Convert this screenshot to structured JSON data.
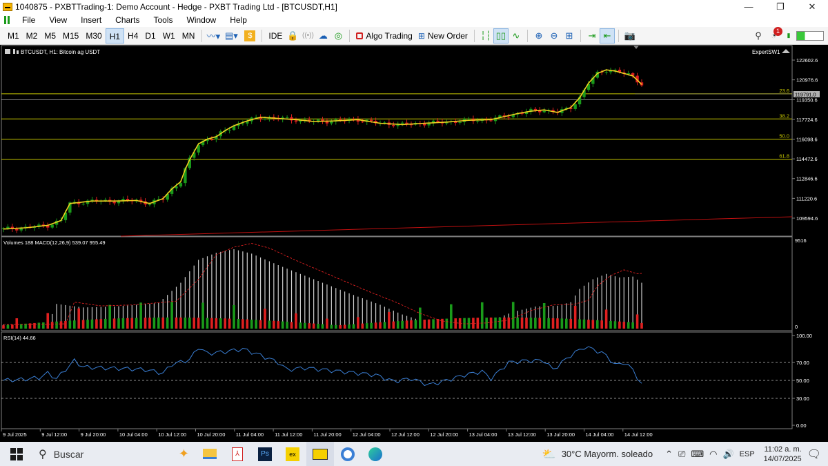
{
  "window": {
    "title": "1040875 - PXBTTrading-1: Demo Account - Hedge - PXBT Trading Ltd - [BTCUSDT,H1]",
    "controls": [
      "minimize",
      "restore",
      "close"
    ]
  },
  "menu": {
    "items": [
      "File",
      "View",
      "Insert",
      "Charts",
      "Tools",
      "Window",
      "Help"
    ]
  },
  "toolbar": {
    "timeframes": [
      "M1",
      "M2",
      "M5",
      "M15",
      "M30",
      "H1",
      "H4",
      "D1",
      "W1",
      "MN"
    ],
    "active_timeframe": "H1",
    "ide_label": "IDE",
    "algo_label": "Algo Trading",
    "order_label": "New Order",
    "notification_count": "1"
  },
  "chart": {
    "header": "BTCUSDT, H1:  Bitcoin ag USDT",
    "expert": "ExpertSW1",
    "current_price": "119791.0",
    "price_ticks": [
      "122602.6",
      "120976.6",
      "119350.6",
      "117724.6",
      "116098.6",
      "114472.6",
      "112846.6",
      "111220.6",
      "109594.6"
    ],
    "fib_levels": [
      {
        "label": "23.6",
        "price": 119830
      },
      {
        "label": "38.2",
        "price": 117760
      },
      {
        "label": "50.0",
        "price": 116100
      },
      {
        "label": "61.8",
        "price": 114440
      }
    ],
    "volume_header": "Volumes 188 MACD(12,26,9) 539.07 955.49",
    "volume_max_label": "9516",
    "volume_zero_label": "0",
    "rsi_header": "RSI(14) 44.66",
    "rsi_ticks": [
      "100.00",
      "70.00",
      "50.00",
      "30.00",
      "0.00"
    ],
    "time_labels": [
      "9 Jul 2025",
      "9 Jul 12:00",
      "9 Jul 20:00",
      "10 Jul 04:00",
      "10 Jul 12:00",
      "10 Jul 20:00",
      "11 Jul 04:00",
      "11 Jul 12:00",
      "11 Jul 20:00",
      "12 Jul 04:00",
      "12 Jul 12:00",
      "12 Jul 20:00",
      "13 Jul 04:00",
      "13 Jul 12:00",
      "13 Jul 20:00",
      "14 Jul 04:00",
      "14 Jul 12:00"
    ],
    "colors": {
      "up": "#1a9a1a",
      "down": "#e02020",
      "ma": "#f0d020",
      "fib": "#c8c800",
      "rsi": "#3a7fd5",
      "trend": "#c01010"
    }
  },
  "chart_data": {
    "type": "candlestick",
    "title": "BTCUSDT, H1",
    "close_points": [
      [
        0,
        108700
      ],
      [
        5,
        108800
      ],
      [
        10,
        109000
      ],
      [
        13,
        109400
      ],
      [
        15,
        110800
      ],
      [
        20,
        111000
      ],
      [
        25,
        111000
      ],
      [
        30,
        111050
      ],
      [
        33,
        110800
      ],
      [
        36,
        111200
      ],
      [
        38,
        112000
      ],
      [
        40,
        112600
      ],
      [
        41,
        113600
      ],
      [
        42,
        114400
      ],
      [
        44,
        115700
      ],
      [
        46,
        116100
      ],
      [
        48,
        116300
      ],
      [
        50,
        116800
      ],
      [
        52,
        117200
      ],
      [
        55,
        117600
      ],
      [
        58,
        117900
      ],
      [
        62,
        117800
      ],
      [
        66,
        117700
      ],
      [
        70,
        117550
      ],
      [
        75,
        117600
      ],
      [
        80,
        117700
      ],
      [
        85,
        117400
      ],
      [
        90,
        117300
      ],
      [
        95,
        117400
      ],
      [
        100,
        117500
      ],
      [
        105,
        117650
      ],
      [
        110,
        117700
      ],
      [
        113,
        117950
      ],
      [
        116,
        118200
      ],
      [
        119,
        118400
      ],
      [
        122,
        118500
      ],
      [
        125,
        118300
      ],
      [
        128,
        118700
      ],
      [
        130,
        119500
      ],
      [
        132,
        120700
      ],
      [
        134,
        121500
      ],
      [
        136,
        121800
      ],
      [
        138,
        121700
      ],
      [
        140,
        121500
      ],
      [
        142,
        121300
      ],
      [
        144,
        120600
      ]
    ],
    "volume_points": [
      [
        0,
        450
      ],
      [
        10,
        500
      ],
      [
        12,
        2800
      ],
      [
        18,
        2400
      ],
      [
        25,
        2500
      ],
      [
        35,
        2900
      ],
      [
        40,
        5200
      ],
      [
        44,
        7800
      ],
      [
        48,
        8600
      ],
      [
        52,
        9000
      ],
      [
        56,
        8500
      ],
      [
        62,
        7200
      ],
      [
        70,
        5600
      ],
      [
        78,
        4000
      ],
      [
        85,
        2700
      ],
      [
        90,
        1600
      ],
      [
        95,
        800
      ],
      [
        100,
        500
      ],
      [
        105,
        600
      ],
      [
        110,
        900
      ],
      [
        115,
        1900
      ],
      [
        120,
        2500
      ],
      [
        125,
        2600
      ],
      [
        128,
        3000
      ],
      [
        130,
        4500
      ],
      [
        133,
        5600
      ],
      [
        136,
        6200
      ],
      [
        139,
        5800
      ],
      [
        142,
        5900
      ],
      [
        144,
        5200
      ]
    ],
    "rsi_points": [
      [
        0,
        50
      ],
      [
        4,
        51
      ],
      [
        8,
        53
      ],
      [
        10,
        58
      ],
      [
        12,
        52
      ],
      [
        16,
        72
      ],
      [
        18,
        65
      ],
      [
        22,
        64
      ],
      [
        28,
        63
      ],
      [
        32,
        62
      ],
      [
        36,
        58
      ],
      [
        38,
        68
      ],
      [
        42,
        73
      ],
      [
        44,
        87
      ],
      [
        46,
        80
      ],
      [
        50,
        82
      ],
      [
        54,
        85
      ],
      [
        58,
        78
      ],
      [
        62,
        70
      ],
      [
        64,
        62
      ],
      [
        68,
        64
      ],
      [
        72,
        62
      ],
      [
        76,
        60
      ],
      [
        80,
        58
      ],
      [
        84,
        56
      ],
      [
        88,
        49
      ],
      [
        92,
        52
      ],
      [
        96,
        45
      ],
      [
        100,
        50
      ],
      [
        104,
        56
      ],
      [
        108,
        60
      ],
      [
        110,
        52
      ],
      [
        114,
        70
      ],
      [
        118,
        72
      ],
      [
        122,
        72
      ],
      [
        124,
        62
      ],
      [
        128,
        78
      ],
      [
        131,
        87
      ],
      [
        133,
        85
      ],
      [
        136,
        78
      ],
      [
        138,
        67
      ],
      [
        140,
        70
      ],
      [
        142,
        62
      ],
      [
        144,
        45
      ]
    ],
    "xlim": [
      0,
      144
    ],
    "ylim_price": [
      108400,
      123400
    ],
    "ylim_rsi": [
      0,
      100
    ],
    "series": [
      {
        "name": "BTCUSDT"
      },
      {
        "name": "Volumes"
      },
      {
        "name": "MACD(12,26,9)"
      },
      {
        "name": "RSI(14)"
      }
    ]
  },
  "taskbar": {
    "search_label": "Buscar",
    "weather": "30°C  Mayorm. soleado",
    "lang": "ESP",
    "time": "11:02 a. m.",
    "date": "14/07/2025"
  }
}
